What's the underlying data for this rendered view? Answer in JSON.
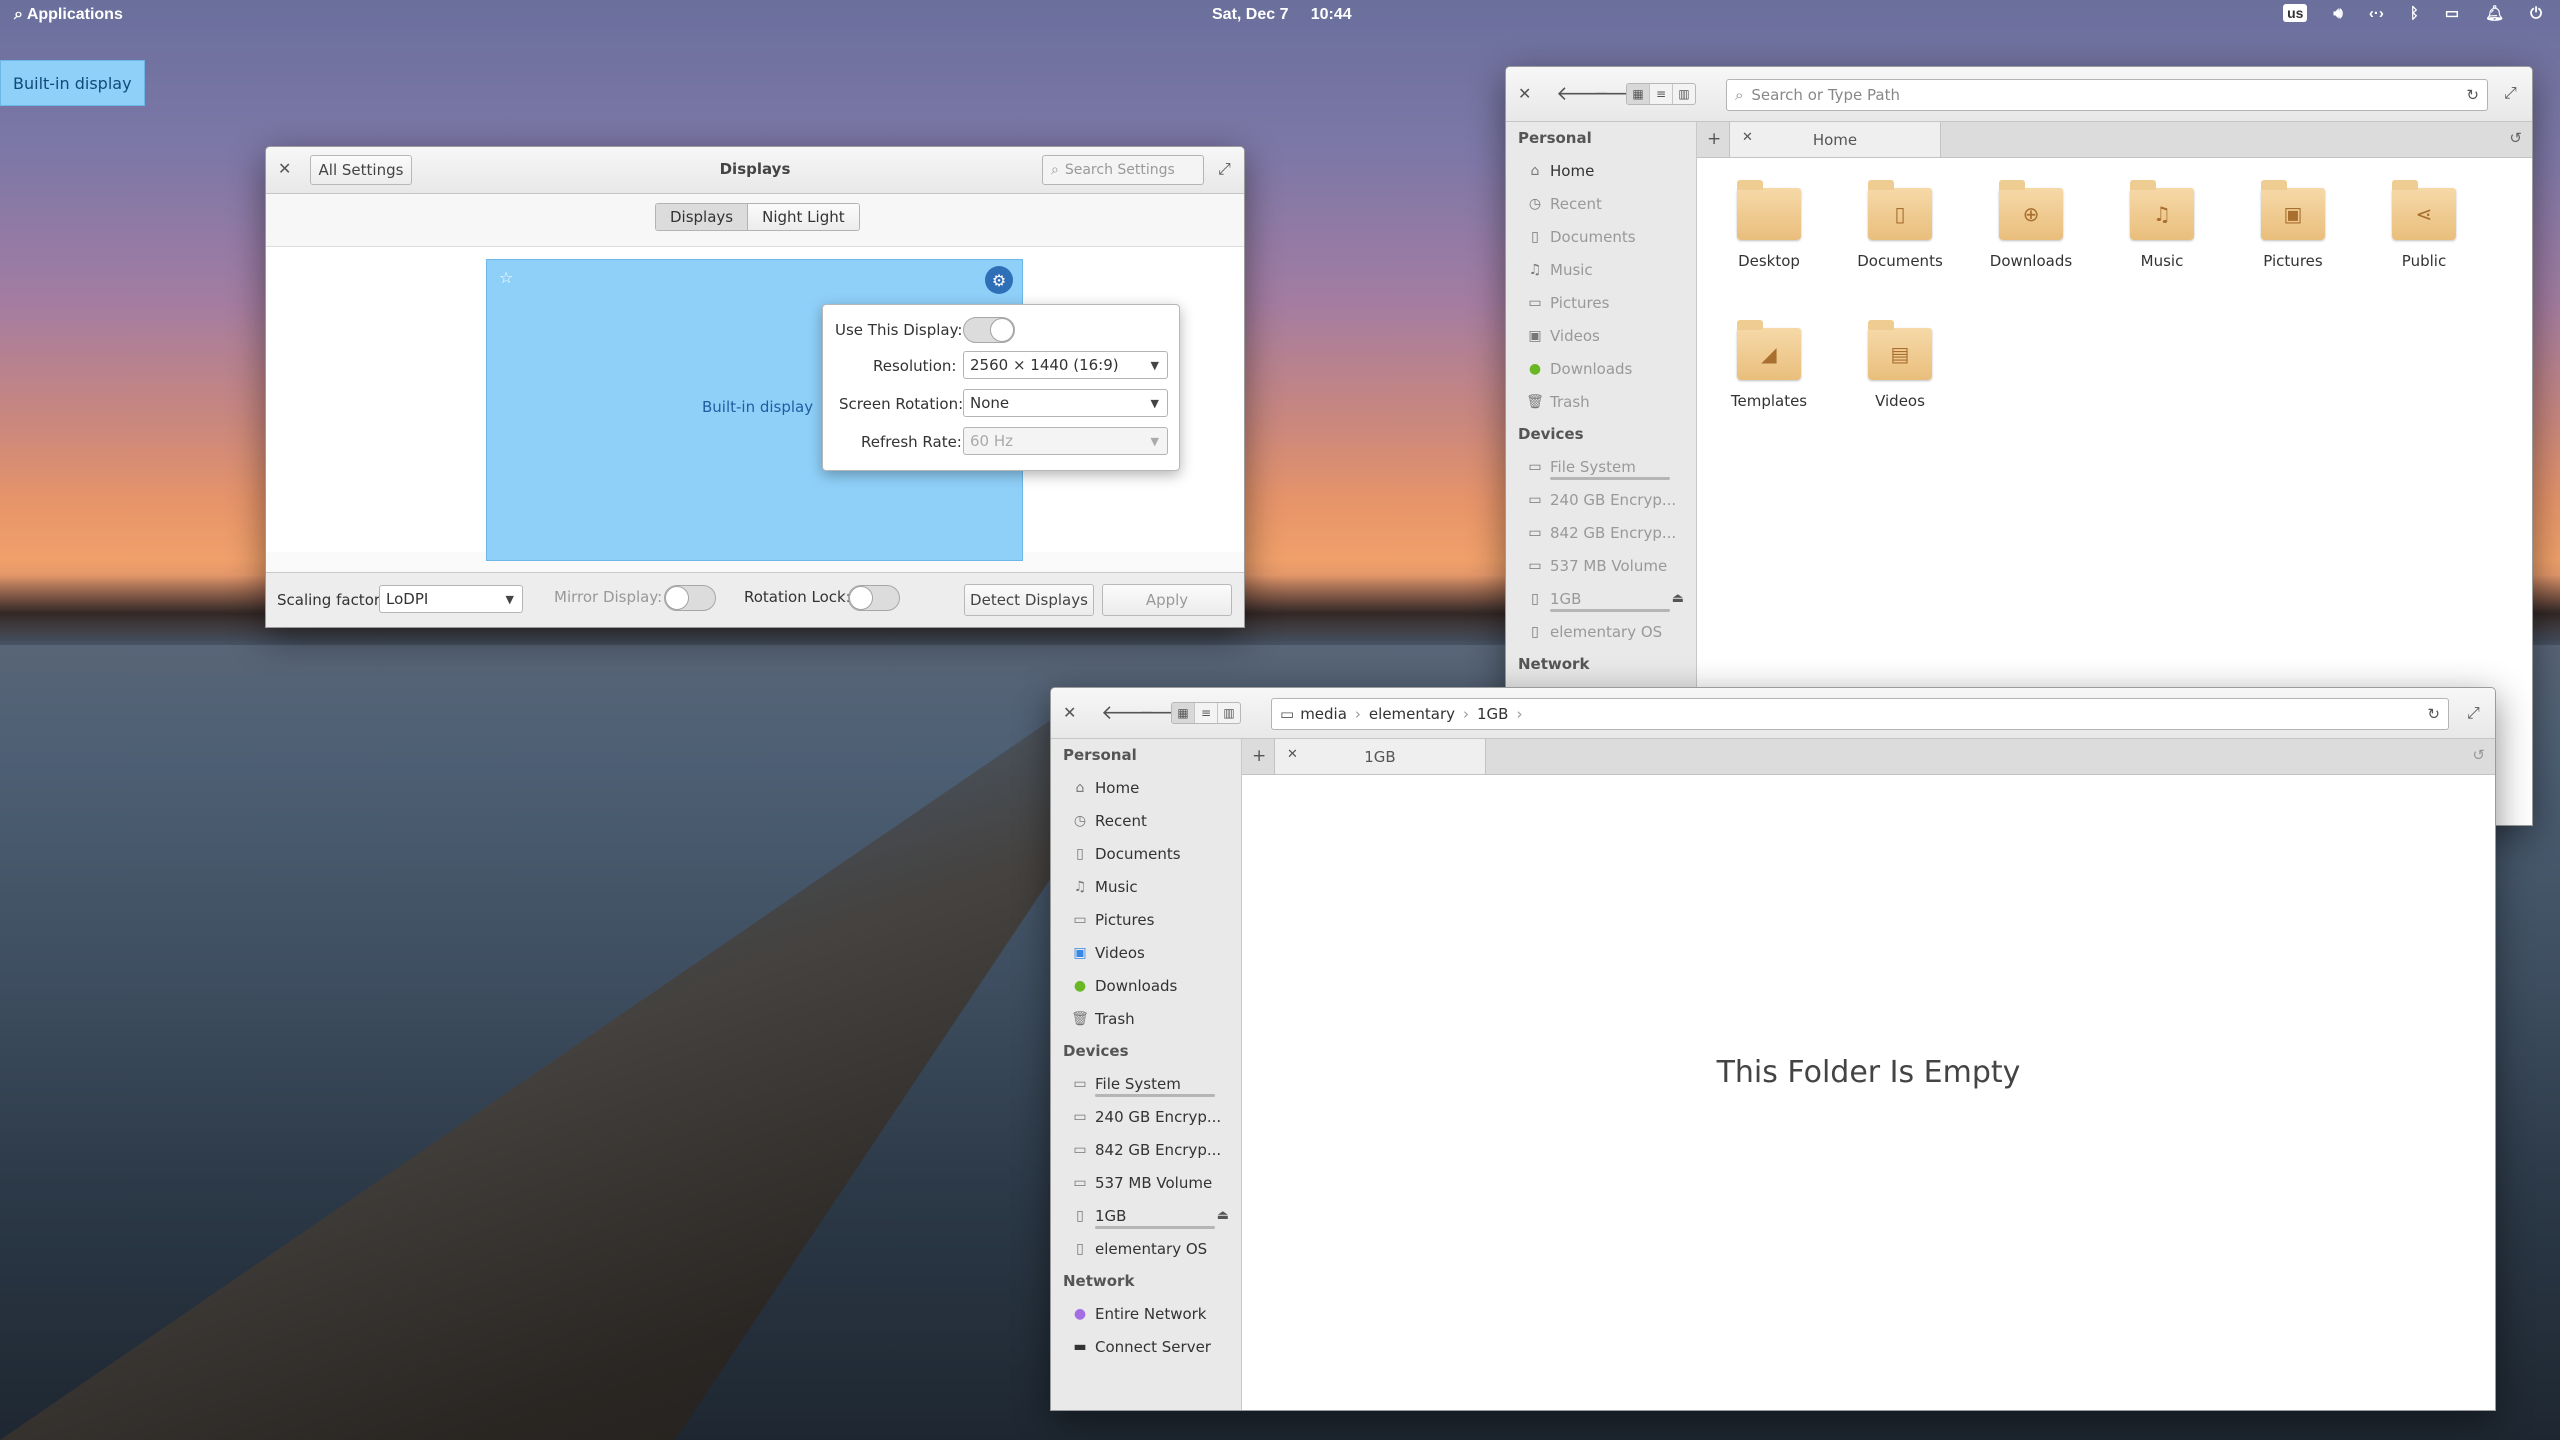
{
  "panel": {
    "applications": "Applications",
    "date": "Sat, Dec 7",
    "time": "10:44",
    "keyboard": "us"
  },
  "osd": {
    "label": "Built-in display"
  },
  "settings": {
    "title": "Displays",
    "back_label": "All Settings",
    "search_placeholder": "Search Settings",
    "tabs": [
      "Displays",
      "Night Light"
    ],
    "monitor_label": "Built-in display",
    "popover": {
      "use_display_label": "Use This Display:",
      "resolution_label": "Resolution:",
      "resolution_value": "2560 × 1440 (16:9)",
      "rotation_label": "Screen Rotation:",
      "rotation_value": "None",
      "refresh_label": "Refresh Rate:",
      "refresh_value": "60 Hz"
    },
    "footer": {
      "scaling_label": "Scaling factor:",
      "scaling_value": "LoDPI",
      "mirror_label": "Mirror Display:",
      "rotation_lock_label": "Rotation Lock:",
      "detect_label": "Detect Displays",
      "apply_label": "Apply"
    },
    "accent": "#8fd0f9"
  },
  "files_home": {
    "path_placeholder": "Search or Type Path",
    "tab_label": "Home",
    "sidebar": {
      "personal_header": "Personal",
      "personal": [
        "Home",
        "Recent",
        "Documents",
        "Music",
        "Pictures",
        "Videos",
        "Downloads",
        "Trash"
      ],
      "devices_header": "Devices",
      "devices": [
        "File System",
        "240 GB Encryp...",
        "842 GB Encryp...",
        "537 MB Volume",
        "1GB",
        "elementary OS"
      ],
      "network_header": "Network"
    },
    "folders": [
      "Desktop",
      "Documents",
      "Downloads",
      "Music",
      "Pictures",
      "Public",
      "Templates",
      "Videos"
    ]
  },
  "files_media": {
    "breadcrumb": [
      "media",
      "elementary",
      "1GB"
    ],
    "tab_label": "1GB",
    "empty_message": "This Folder Is Empty",
    "sidebar": {
      "personal_header": "Personal",
      "personal": [
        "Home",
        "Recent",
        "Documents",
        "Music",
        "Pictures",
        "Videos",
        "Downloads",
        "Trash"
      ],
      "devices_header": "Devices",
      "devices": [
        "File System",
        "240 GB Encryp...",
        "842 GB Encryp...",
        "537 MB Volume",
        "1GB",
        "elementary OS"
      ],
      "network_header": "Network",
      "network": [
        "Entire Network",
        "Connect Server"
      ]
    }
  }
}
